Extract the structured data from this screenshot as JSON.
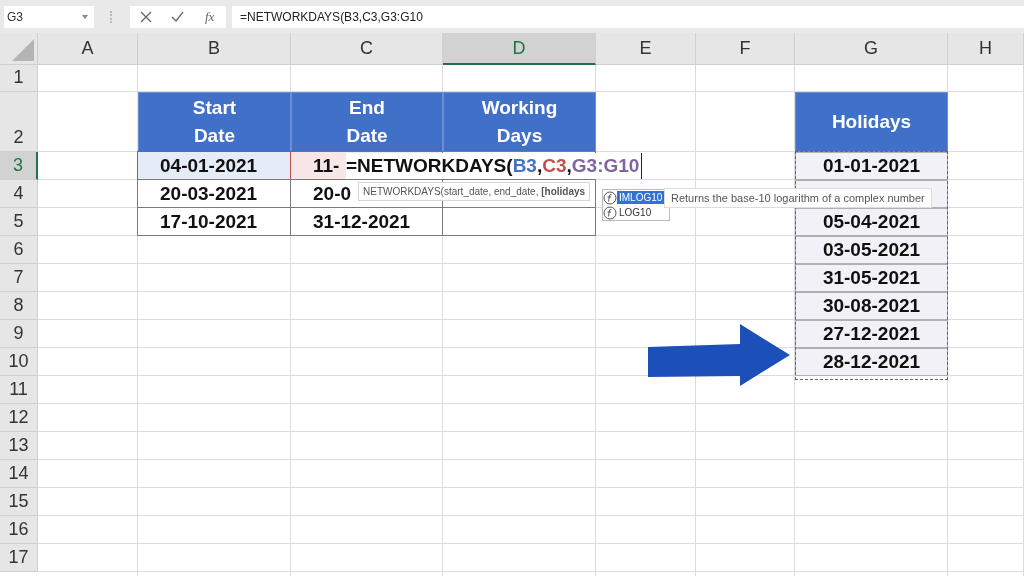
{
  "name_box": "G3",
  "formula_bar": {
    "insert_function": "fx",
    "formula": "=NETWORKDAYS(B3,C3,G3:G10"
  },
  "columns": [
    {
      "label": "A",
      "selected": false
    },
    {
      "label": "B",
      "selected": false
    },
    {
      "label": "C",
      "selected": false
    },
    {
      "label": "D",
      "selected": true
    },
    {
      "label": "E",
      "selected": false
    },
    {
      "label": "F",
      "selected": false
    },
    {
      "label": "G",
      "selected": false
    },
    {
      "label": "H",
      "selected": false
    }
  ],
  "rows": [
    {
      "label": "1",
      "selected": false
    },
    {
      "label": "2",
      "selected": false
    },
    {
      "label": "3",
      "selected": true
    },
    {
      "label": "4",
      "selected": false
    },
    {
      "label": "5",
      "selected": false
    },
    {
      "label": "6",
      "selected": false
    },
    {
      "label": "7",
      "selected": false
    },
    {
      "label": "8",
      "selected": false
    },
    {
      "label": "9",
      "selected": false
    },
    {
      "label": "10",
      "selected": false
    },
    {
      "label": "11",
      "selected": false
    },
    {
      "label": "12",
      "selected": false
    },
    {
      "label": "13",
      "selected": false
    },
    {
      "label": "14",
      "selected": false
    },
    {
      "label": "15",
      "selected": false
    },
    {
      "label": "16",
      "selected": false
    },
    {
      "label": "17",
      "selected": false
    }
  ],
  "table": {
    "headers": [
      "Start Date",
      "End Date",
      "Working Days"
    ],
    "rows": [
      {
        "start": {
          "text": "04-01-2021",
          "color": "#4472c4"
        },
        "end": {
          "text": "11-",
          "color": "#c0504d"
        }
      },
      {
        "start": {
          "text": "20-03-2021"
        },
        "end": {
          "text": "20-0"
        }
      },
      {
        "start": {
          "text": "17-10-2021"
        },
        "end": {
          "text": "31-12-2021"
        }
      }
    ]
  },
  "holidays": {
    "header": "Holidays",
    "values": [
      "01-01-2021",
      "05-04-2021",
      "03-05-2021",
      "31-05-2021",
      "30-08-2021",
      "27-12-2021",
      "28-12-2021"
    ]
  },
  "cell_edit": {
    "parts": [
      {
        "text": "=NETWORKDAYS("
      },
      {
        "text": "B3",
        "color": "#4472c4"
      },
      {
        "text": ","
      },
      {
        "text": "C3",
        "color": "#c0504d"
      },
      {
        "text": ","
      },
      {
        "text": "G3:G10",
        "color": "#8064a2"
      }
    ]
  },
  "syntax_tooltip": "NETWORKDAYS(start_date, end_date, **[holidays**",
  "autocomplete": {
    "items": [
      {
        "label": "IMLOG10",
        "selected": true
      },
      {
        "label": "LOG10",
        "selected": false
      }
    ],
    "description": "Returns the base-10 logarithm of a complex number"
  }
}
